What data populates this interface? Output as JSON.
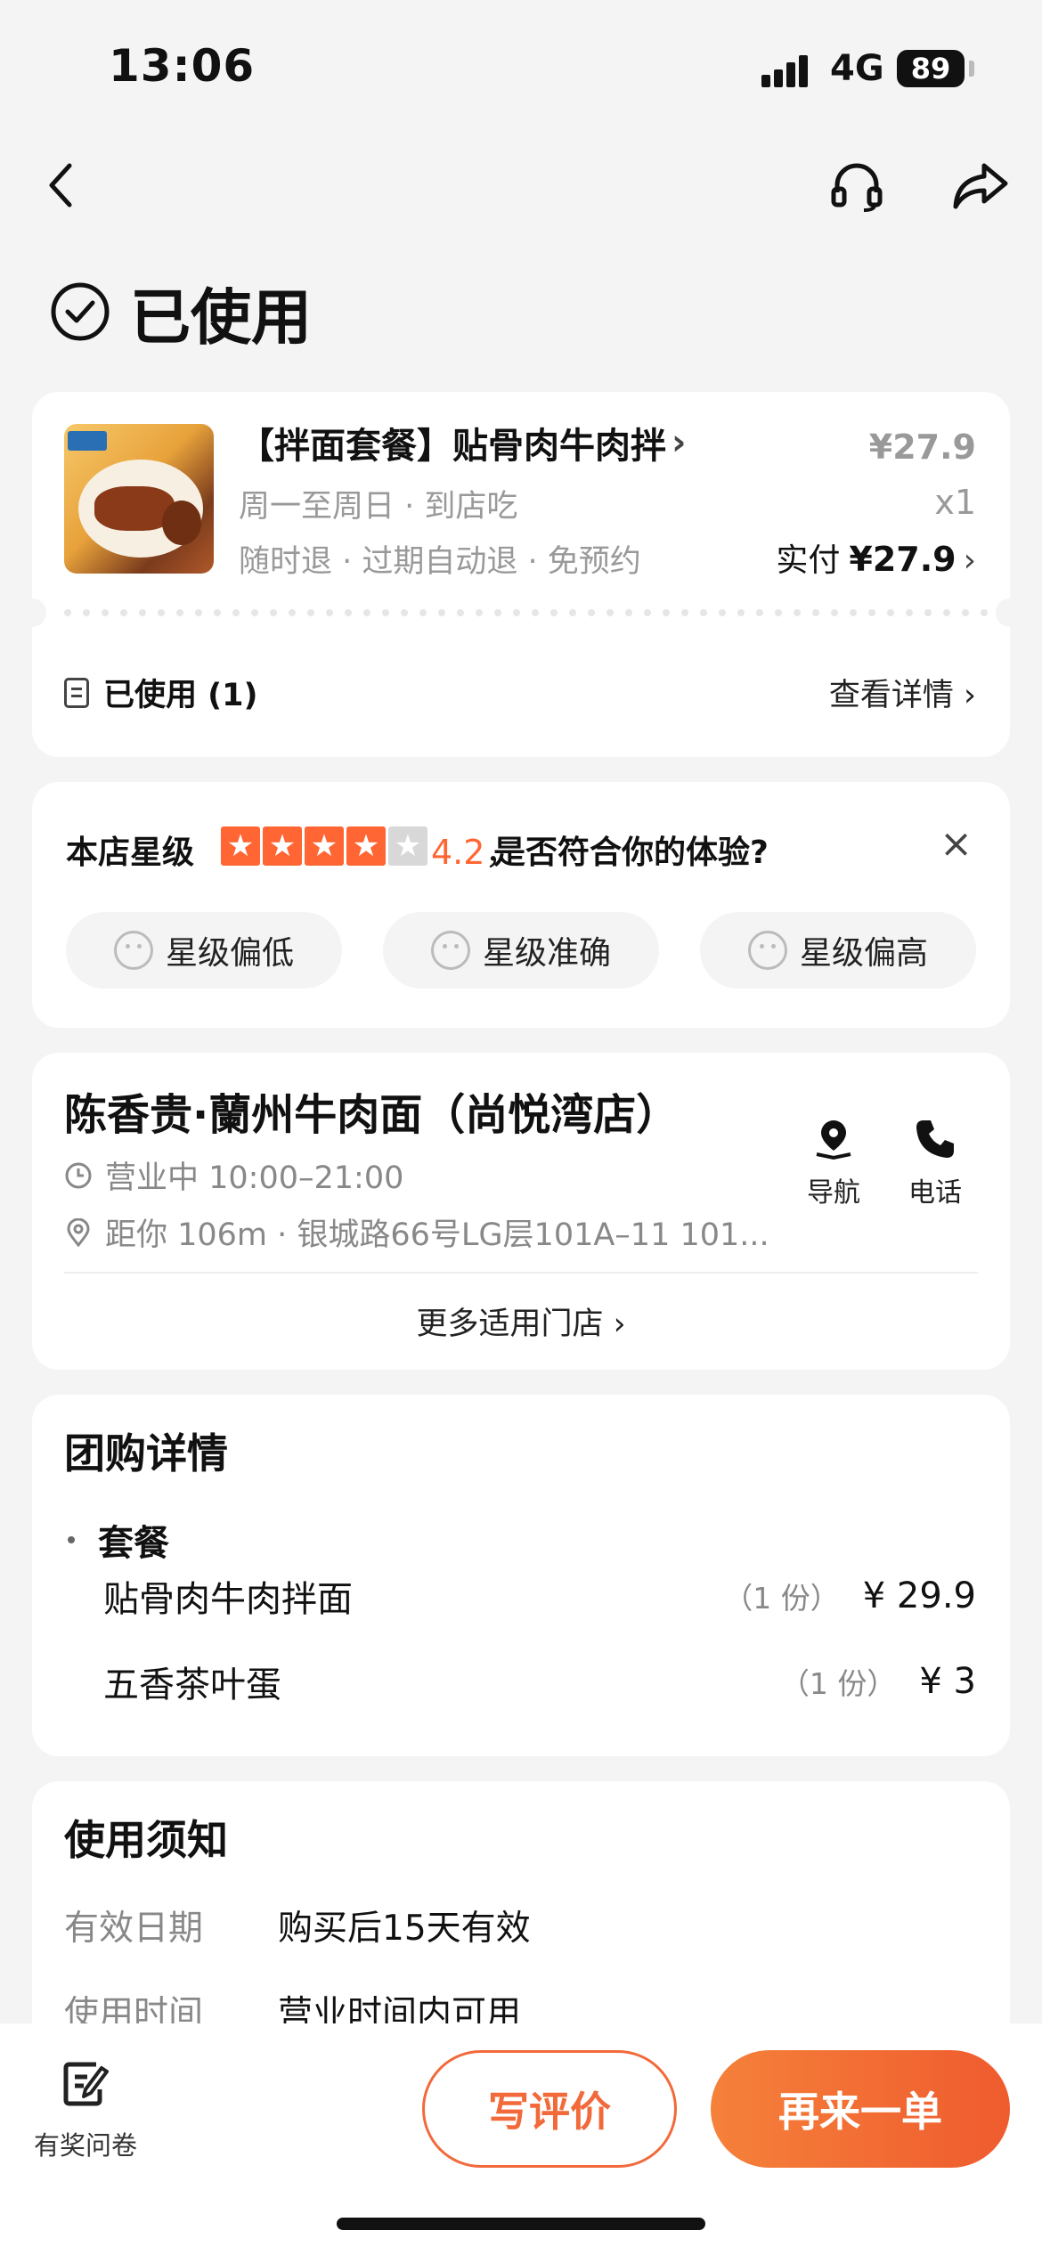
{
  "status_bar": {
    "time": "13:06",
    "network": "4G",
    "battery": "89"
  },
  "header": {
    "back_icon": "chevron-left-icon",
    "support_icon": "headset-icon",
    "share_icon": "share-arrow-icon"
  },
  "page": {
    "title": "已使用",
    "title_icon": "check-circle-icon"
  },
  "order": {
    "name": "【拌面套餐】贴骨肉牛肉拌",
    "chevron": "›",
    "schedule": "周一至周日 · 到店吃",
    "refund": "随时退 · 过期自动退 · 免预约",
    "original_price": "¥27.9",
    "quantity": "x1",
    "paid_label": "实付",
    "paid_amount": "¥27.9",
    "used_label": "已使用 (1)",
    "details_link": "查看详情 ›"
  },
  "rating": {
    "label": "本店星级",
    "stars_filled": 4,
    "stars_total": 5,
    "score": "4.2",
    "separator": "，",
    "question": "是否符合你的体验?",
    "close": "×",
    "options": [
      "星级偏低",
      "星级准确",
      "星级偏高"
    ],
    "star_color": "#ff6633"
  },
  "store": {
    "name": "陈香贵·蘭州牛肉面（尚悦湾店）",
    "hours": "营业中 10:00–21:00",
    "address": "距你 106m ·  银城路66号LG层101A–11 101...",
    "nav_label": "导航",
    "phone_label": "电话",
    "more_stores": "更多适用门店 ›"
  },
  "deal": {
    "title": "团购详情",
    "group": "套餐",
    "items": [
      {
        "name": "贴骨肉牛肉拌面",
        "count": "（1 份）",
        "price": "¥ 29.9"
      },
      {
        "name": "五香茶叶蛋",
        "count": "（1 份）",
        "price": "¥ 3"
      }
    ]
  },
  "notice": {
    "title": "使用须知",
    "rows": [
      {
        "k": "有效日期",
        "v": "购买后15天有效"
      },
      {
        "k": "使用时间",
        "v": "营业时间内可用"
      }
    ]
  },
  "bottom": {
    "survey": "有奖问卷",
    "review": "写评价",
    "reorder": "再来一单"
  },
  "colors": {
    "accent": "#f26a3b",
    "background": "#f4f4f4"
  }
}
